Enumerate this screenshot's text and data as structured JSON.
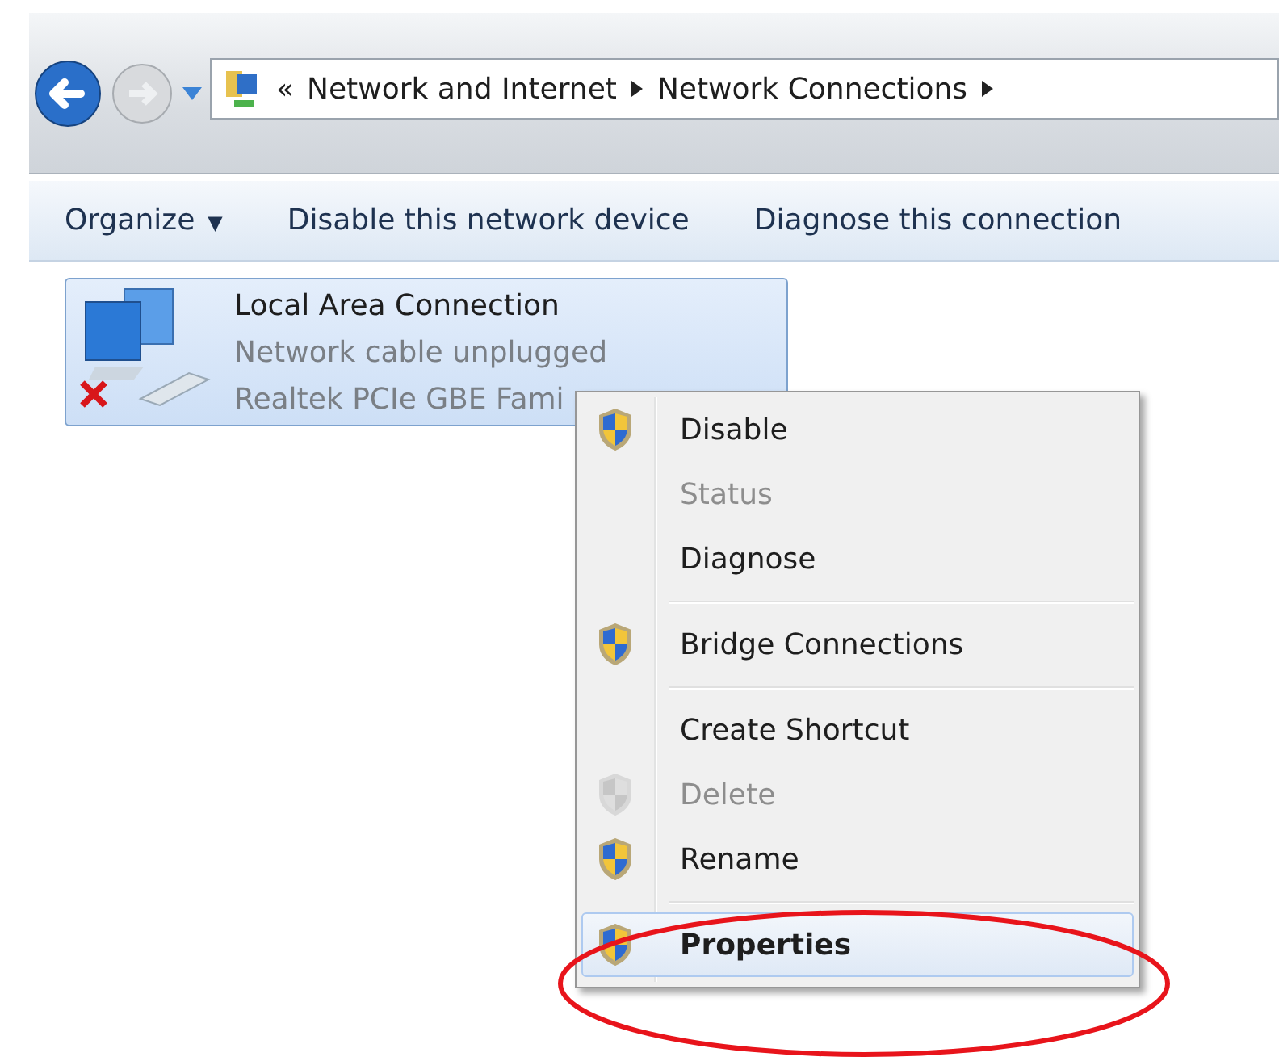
{
  "address_bar": {
    "prefix": "«",
    "crumbs": [
      "Network and Internet",
      "Network Connections"
    ]
  },
  "toolbar": [
    "Organize",
    "Disable this network device",
    "Diagnose this connection"
  ],
  "organize_caret": "▼",
  "connection": {
    "name": "Local Area Connection",
    "status": "Network cable unplugged",
    "device": "Realtek PCIe GBE Fami",
    "selected": true,
    "disconnected": true
  },
  "context_menu": [
    {
      "kind": "item",
      "label": "Disable",
      "shield": true,
      "disabled": false,
      "default": false,
      "selected": false
    },
    {
      "kind": "item",
      "label": "Status",
      "shield": false,
      "disabled": true,
      "default": false,
      "selected": false
    },
    {
      "kind": "item",
      "label": "Diagnose",
      "shield": false,
      "disabled": false,
      "default": false,
      "selected": false
    },
    {
      "kind": "separator"
    },
    {
      "kind": "item",
      "label": "Bridge Connections",
      "shield": true,
      "disabled": false,
      "default": false,
      "selected": false
    },
    {
      "kind": "separator"
    },
    {
      "kind": "item",
      "label": "Create Shortcut",
      "shield": false,
      "disabled": false,
      "default": false,
      "selected": false
    },
    {
      "kind": "item",
      "label": "Delete",
      "shield": true,
      "disabled": true,
      "default": false,
      "selected": false
    },
    {
      "kind": "item",
      "label": "Rename",
      "shield": true,
      "disabled": false,
      "default": false,
      "selected": false
    },
    {
      "kind": "separator"
    },
    {
      "kind": "item",
      "label": "Properties",
      "shield": true,
      "disabled": false,
      "default": true,
      "selected": true
    }
  ],
  "annotation": {
    "kind": "ellipse",
    "color": "#e8141b"
  }
}
